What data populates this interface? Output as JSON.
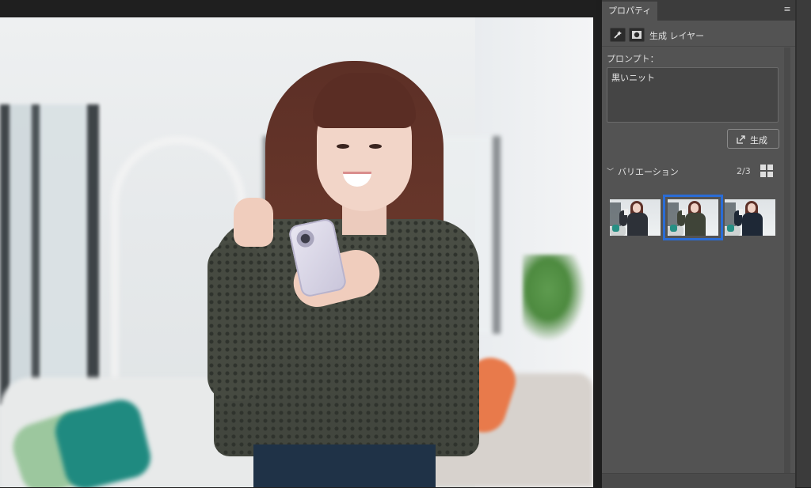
{
  "panel": {
    "tab_title": "プロパティ",
    "layer_type": "生成 レイヤー",
    "prompt_label": "プロンプト：",
    "prompt_value": "黒いニット",
    "generate_label": "生成",
    "variations_label": "バリエーション",
    "variations_count": "2/3",
    "selected_variation": 2
  },
  "variations": [
    {
      "sweater_color": "#2d3138"
    },
    {
      "sweater_color": "#3f4438"
    },
    {
      "sweater_color": "#1e2836"
    }
  ],
  "colors": {
    "panel_bg": "#535353",
    "selection_outline": "#2a6cd6",
    "app_bg": "#1e1e1e"
  },
  "icons": {
    "generative-layer": "sparkle-icon",
    "mask": "mask-icon",
    "generate": "external-generate-icon",
    "grid": "grid-view-icon",
    "menu": "panel-menu-icon",
    "chevron": "chevron-down-icon"
  }
}
